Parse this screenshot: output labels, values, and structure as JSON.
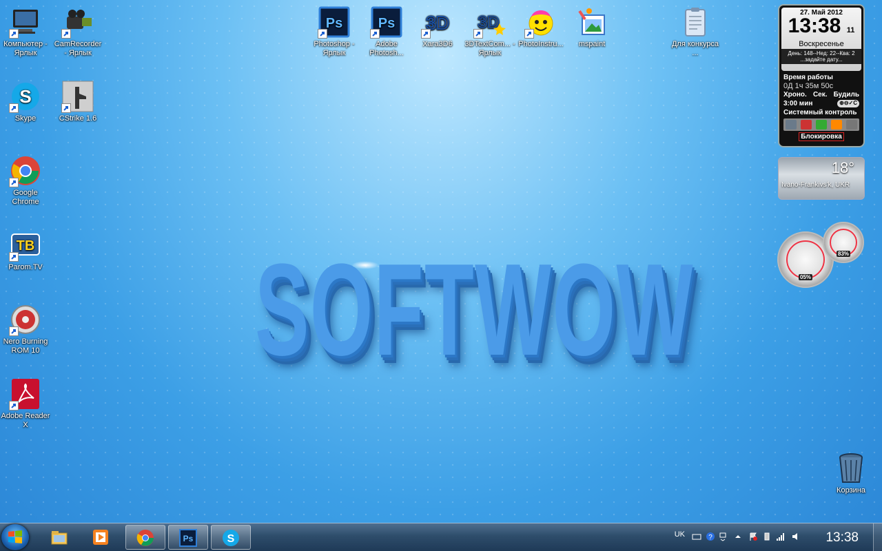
{
  "desktop_icons": [
    {
      "label": "Компьютер - Ярлык",
      "icon": "computer-icon"
    },
    {
      "label": "CamRecorder - Ярлык",
      "icon": "camcorder-icon"
    },
    {
      "label": "Skype",
      "icon": "skype-icon"
    },
    {
      "label": "CStrike 1.6",
      "icon": "counter-strike-icon"
    },
    {
      "label": "Google Chrome",
      "icon": "chrome-icon"
    },
    {
      "label": "Parom.TV",
      "icon": "tv-icon"
    },
    {
      "label": "Nero Burning ROM 10",
      "icon": "nero-icon"
    },
    {
      "label": "Adobe Reader X",
      "icon": "adobe-reader-icon"
    },
    {
      "label": "Photoshop - Ярлык",
      "icon": "photoshop-icon"
    },
    {
      "label": "Adobe Photosh...",
      "icon": "photoshop-icon"
    },
    {
      "label": "Xara3D6",
      "icon": "xara3d-icon"
    },
    {
      "label": "3DTextCom... - Ярлык",
      "icon": "3dtext-icon"
    },
    {
      "label": "PhotoInstru...",
      "icon": "smiley-icon"
    },
    {
      "label": "mspaint",
      "icon": "paint-icon"
    },
    {
      "label": "Для конкурса ...",
      "icon": "clipboard-icon"
    },
    {
      "label": "Корзина",
      "icon": "recycle-bin-icon"
    }
  ],
  "wallpaper": {
    "text": "SOFTWOW"
  },
  "clock_gadget": {
    "date": "27. Май 2012",
    "time": "13:38",
    "seconds": "11",
    "weekday": "Воскресенье",
    "info_line1": "День: 148--Нед: 22--Ква: 2",
    "info_line2": "...задайте дату...",
    "uptime_label": "Время работы",
    "uptime_value": "0Д 1ч 35м 50с",
    "chrono": "Хроно.",
    "sec": "Сек.",
    "alarm": "Будиль",
    "timer": "3:00 мин",
    "system_control": "Системный контроль",
    "lock": "Блокировка"
  },
  "weather_gadget": {
    "temp": "18°",
    "city": "Ivano-Frankivs'k, UKR"
  },
  "cpu_gadget": {
    "cpu": "05%",
    "ram": "83%",
    "cpu_level": 0.05,
    "ram_level": 0.83
  },
  "taskbar": {
    "pinned": [
      "explorer-icon",
      "media-player-icon",
      "chrome-icon",
      "photoshop-icon",
      "skype-icon"
    ],
    "tray_lang": "UK",
    "tray_time": "13:38"
  },
  "colors": {
    "wallpaper": "#3c9fe6",
    "logo": "#4b9be8",
    "taskbar": "#2e4d6b"
  }
}
